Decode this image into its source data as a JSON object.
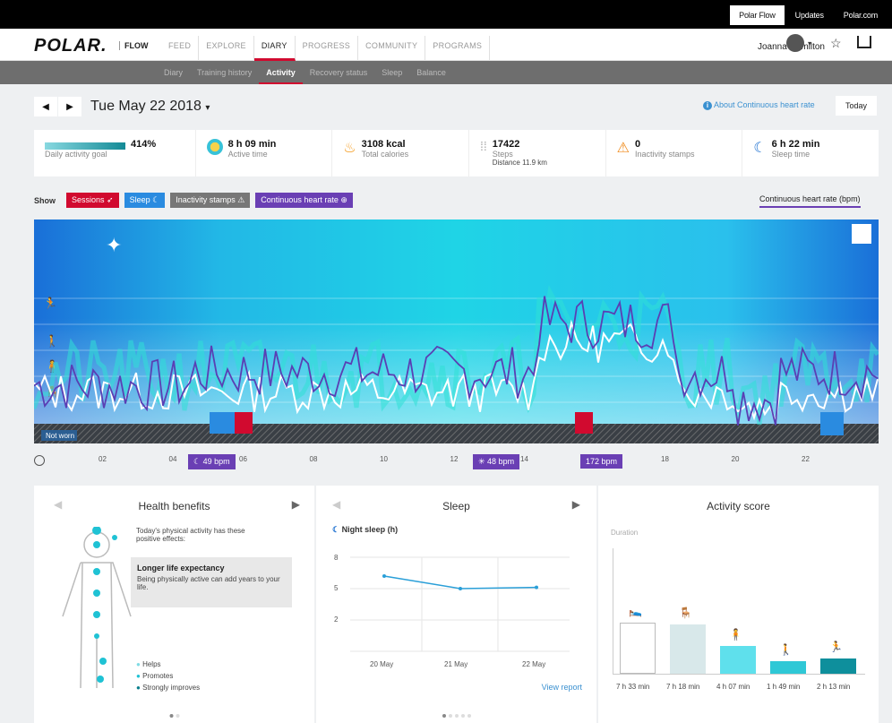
{
  "top": {
    "links": [
      "Polar Flow",
      "Updates",
      "Polar.com"
    ]
  },
  "nav": {
    "logo": "POLAR.",
    "flow": "FLOW",
    "items": [
      "FEED",
      "EXPLORE",
      "DIARY",
      "PROGRESS",
      "COMMUNITY",
      "PROGRAMS"
    ],
    "user": "Joanna Hamilton"
  },
  "subnav": {
    "items": [
      "Diary",
      "Training history",
      "Activity",
      "Recovery status",
      "Sleep",
      "Balance"
    ]
  },
  "date": {
    "label": "Tue May 22 2018",
    "about": "About Continuous heart rate",
    "today": "Today"
  },
  "stats": {
    "goal": {
      "value": "414%",
      "label": "Daily activity goal",
      "fill": 1.0
    },
    "active": {
      "value": "8 h 09 min",
      "label": "Active time"
    },
    "calories": {
      "value": "3108 kcal",
      "label": "Total calories"
    },
    "steps": {
      "value": "17422",
      "label": "Steps",
      "distance": "Distance 11.9 km"
    },
    "inactivity": {
      "value": "0",
      "label": "Inactivity stamps"
    },
    "sleep": {
      "value": "6 h 22 min",
      "label": "Sleep time"
    }
  },
  "show": {
    "label": "Show",
    "tags": [
      "Sessions",
      "Sleep",
      "Inactivity stamps",
      "Continuous heart rate"
    ],
    "hr_link": "Continuous heart rate (bpm)"
  },
  "chart": {
    "not_worn": "Not worn",
    "bpm_a": "49 bpm",
    "bpm_b": "48 bpm",
    "bpm_c": "172 bpm",
    "ticks": [
      "02",
      "04",
      "06",
      "08",
      "10",
      "12",
      "14",
      "16",
      "18",
      "20",
      "22"
    ]
  },
  "health": {
    "title": "Health benefits",
    "intro": "Today's physical activity has these positive effects:",
    "box_title": "Longer life expectancy",
    "box_text": "Being physically active can add years to your life.",
    "legend": [
      "Helps",
      "Promotes",
      "Strongly improves"
    ]
  },
  "sleep": {
    "title": "Sleep",
    "series_label": "Night sleep (h)",
    "y": [
      "8",
      "5",
      "2"
    ],
    "x": [
      "20 May",
      "21 May",
      "22 May"
    ],
    "values": [
      7.0,
      6.0,
      6.1
    ],
    "view": "View report"
  },
  "score": {
    "title": "Activity score",
    "sub": "Duration",
    "labels": [
      "7 h 33 min",
      "7 h 18 min",
      "4 h 07 min",
      "1 h 49 min",
      "2 h 13 min"
    ],
    "values": [
      7.55,
      7.3,
      4.12,
      1.82,
      2.22
    ]
  },
  "colors": {
    "accent": "#d10a2f",
    "teal": "#1fc2d4",
    "purple": "#6a3fb4"
  }
}
